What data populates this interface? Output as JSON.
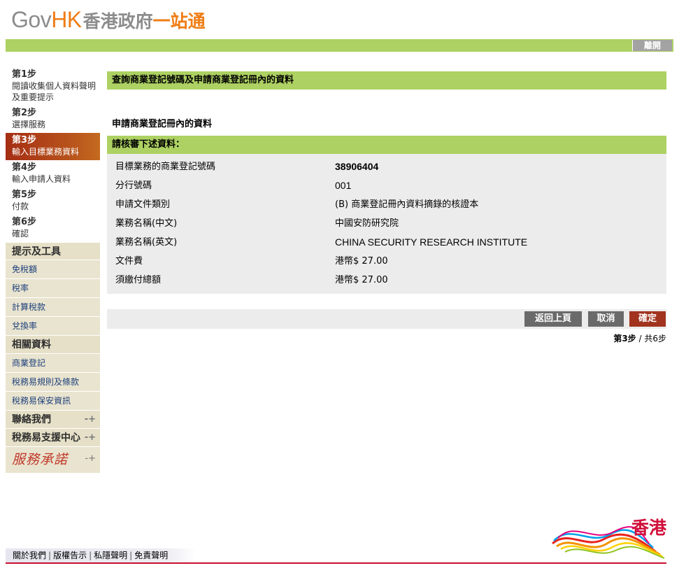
{
  "header": {
    "logo_gov": "Gov",
    "logo_hk": "HK",
    "logo_cn": "香港政府",
    "logo_cn2": "一站通",
    "exit_label": "離開"
  },
  "sidebar": {
    "steps": [
      {
        "number": "第1步",
        "label": "閱讀收集個人資料聲明及重要提示"
      },
      {
        "number": "第2步",
        "label": "選擇服務"
      },
      {
        "number": "第3步",
        "label": "輸入目標業務資料",
        "active": true
      },
      {
        "number": "第4步",
        "label": "輸入申請人資料"
      },
      {
        "number": "第5步",
        "label": "付款"
      },
      {
        "number": "第6步",
        "label": "確認"
      }
    ],
    "tools_heading": "提示及工具",
    "tools": [
      "免稅額",
      "稅率",
      "計算稅款",
      "兌換率"
    ],
    "related_heading": "相關資料",
    "related": [
      "商業登記",
      "稅務易規則及條款",
      "稅務易保安資訊"
    ],
    "contact": "聯絡我們",
    "support": "稅務易支援中心",
    "pledge": "服務承諾"
  },
  "main": {
    "section_title": "查詢商業登記號碼及申請商業登記冊內的資料",
    "sub_title": "申請商業登記冊內的資料",
    "review_heading": "請核審下述資料：",
    "rows": [
      {
        "label": "目標業務的商業登記號碼",
        "value": "38906404"
      },
      {
        "label": "分行號碼",
        "value": "001"
      },
      {
        "label": "申請文件類別",
        "value": "(B) 商業登記冊內資料摘錄的核證本"
      },
      {
        "label": "業務名稱(中文)",
        "value": "中國安防研究院"
      },
      {
        "label": "業務名稱(英文)",
        "value": "CHINA SECURITY RESEARCH INSTITUTE"
      },
      {
        "label": "文件費",
        "value": "港幣$ 27.00"
      },
      {
        "label": "須繳付總額",
        "value": "港幣$ 27.00"
      }
    ],
    "buttons": {
      "back": "返回上頁",
      "cancel": "取消",
      "confirm": "確定"
    },
    "step_current": "第3步",
    "step_sep": " / ",
    "step_total": "共6步"
  },
  "footer": {
    "links": [
      "關於我們",
      "版權告示",
      "私隱聲明",
      "免責聲明"
    ],
    "separator": "|",
    "brand": "香港"
  },
  "colors": {
    "green_bar": "#add162",
    "active_step": "#a52e14",
    "confirm_button": "#a1331f",
    "gray_button": "#6a6a6a",
    "sidebar_bg": "#e9e4cf",
    "footer_line": "#c8102e"
  }
}
